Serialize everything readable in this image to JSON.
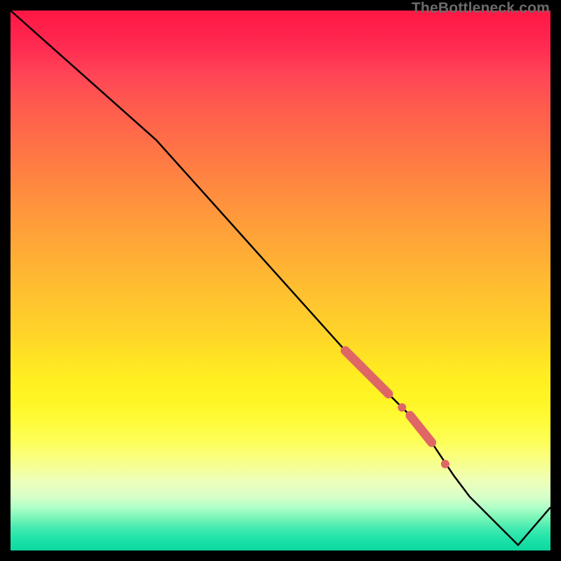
{
  "watermark": "TheBottleneck.com",
  "chart_data": {
    "type": "line",
    "title": "",
    "xlabel": "",
    "ylabel": "",
    "xlim": [
      0,
      100
    ],
    "ylim": [
      0,
      100
    ],
    "grid": false,
    "gradient": {
      "top_color": "#ff1744",
      "mid_color": "#ffee22",
      "bottom_color": "#0cd8a0",
      "meaning": "red-high-bottleneck to green-low-bottleneck"
    },
    "series": [
      {
        "name": "bottleneck-curve",
        "color": "#000000",
        "x": [
          0,
          27,
          62,
          66,
          70,
          74,
          78,
          82,
          85,
          94,
          100
        ],
        "y": [
          100,
          76,
          37,
          33,
          29,
          25,
          20,
          14,
          10,
          1,
          8
        ]
      }
    ],
    "highlights": [
      {
        "name": "highlight-segment-1",
        "color": "#e06666",
        "type": "thick-segment",
        "x": [
          62,
          70
        ],
        "y": [
          37,
          29
        ]
      },
      {
        "name": "highlight-dot-1",
        "color": "#e06666",
        "type": "dot",
        "x": 72.5,
        "y": 26.5
      },
      {
        "name": "highlight-segment-2",
        "color": "#e06666",
        "type": "thick-segment",
        "x": [
          74,
          78
        ],
        "y": [
          25,
          20
        ]
      },
      {
        "name": "highlight-dot-2",
        "color": "#e06666",
        "type": "dot",
        "x": 80.5,
        "y": 16
      }
    ]
  }
}
